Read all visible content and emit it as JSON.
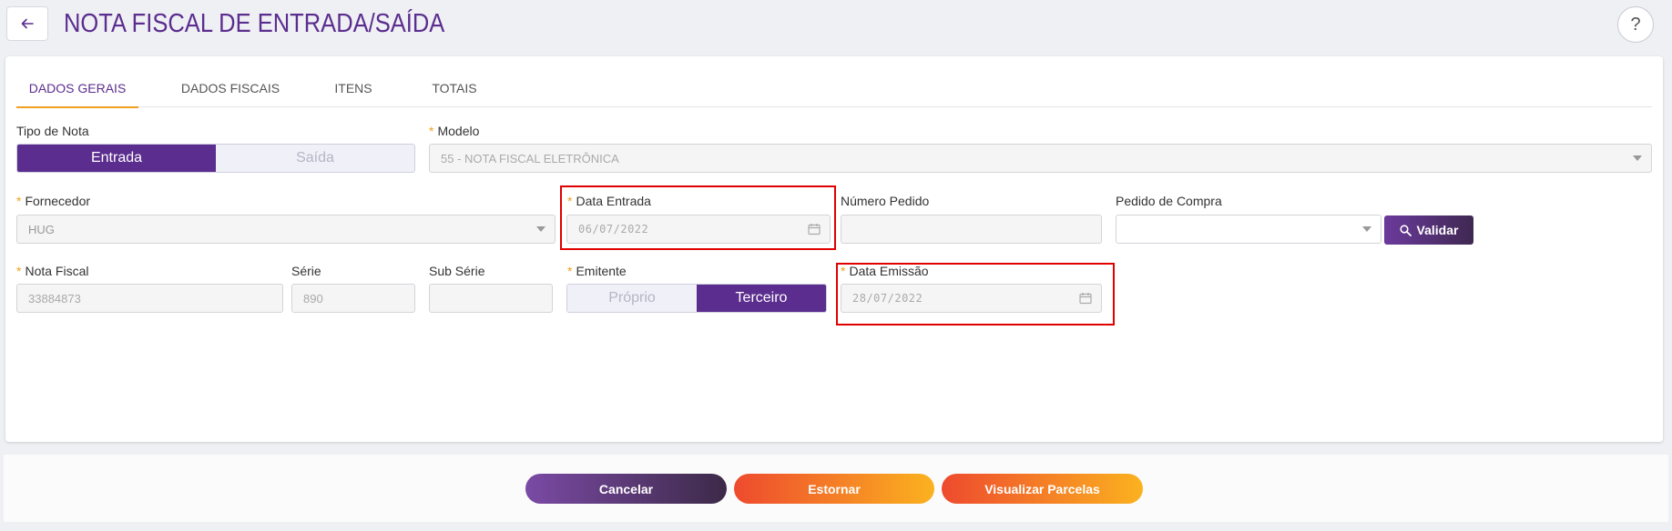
{
  "header": {
    "title": "NOTA FISCAL DE ENTRADA/SAÍDA",
    "help_label": "?"
  },
  "tabs": [
    {
      "label": "DADOS GERAIS",
      "active": true
    },
    {
      "label": "DADOS FISCAIS",
      "active": false
    },
    {
      "label": "ITENS",
      "active": false
    },
    {
      "label": "TOTAIS",
      "active": false
    }
  ],
  "form": {
    "tipo_nota": {
      "label": "Tipo de Nota",
      "options": [
        "Entrada",
        "Saída"
      ],
      "selected": "Entrada"
    },
    "modelo": {
      "label": "Modelo",
      "value": "55 - NOTA FISCAL ELETRÔNICA"
    },
    "fornecedor": {
      "label": "Fornecedor",
      "value": "HUG"
    },
    "data_entrada": {
      "label": "Data Entrada",
      "value": "06/07/2022"
    },
    "numero_pedido": {
      "label": "Número Pedido",
      "value": ""
    },
    "pedido_compra": {
      "label": "Pedido de Compra",
      "value": ""
    },
    "validar_label": "Validar",
    "nota_fiscal": {
      "label": "Nota Fiscal",
      "value": "33884873"
    },
    "serie": {
      "label": "Série",
      "value": "890"
    },
    "sub_serie": {
      "label": "Sub Série",
      "value": ""
    },
    "emitente": {
      "label": "Emitente",
      "options": [
        "Próprio",
        "Terceiro"
      ],
      "selected": "Terceiro"
    },
    "data_emissao": {
      "label": "Data Emissão",
      "value": "28/07/2022"
    }
  },
  "footer": {
    "cancel_label": "Cancelar",
    "estornar_label": "Estornar",
    "parcelas_label": "Visualizar Parcelas"
  },
  "colors": {
    "primary": "#5b2d8e",
    "accent": "#f0a020",
    "highlight": "#e00000"
  }
}
